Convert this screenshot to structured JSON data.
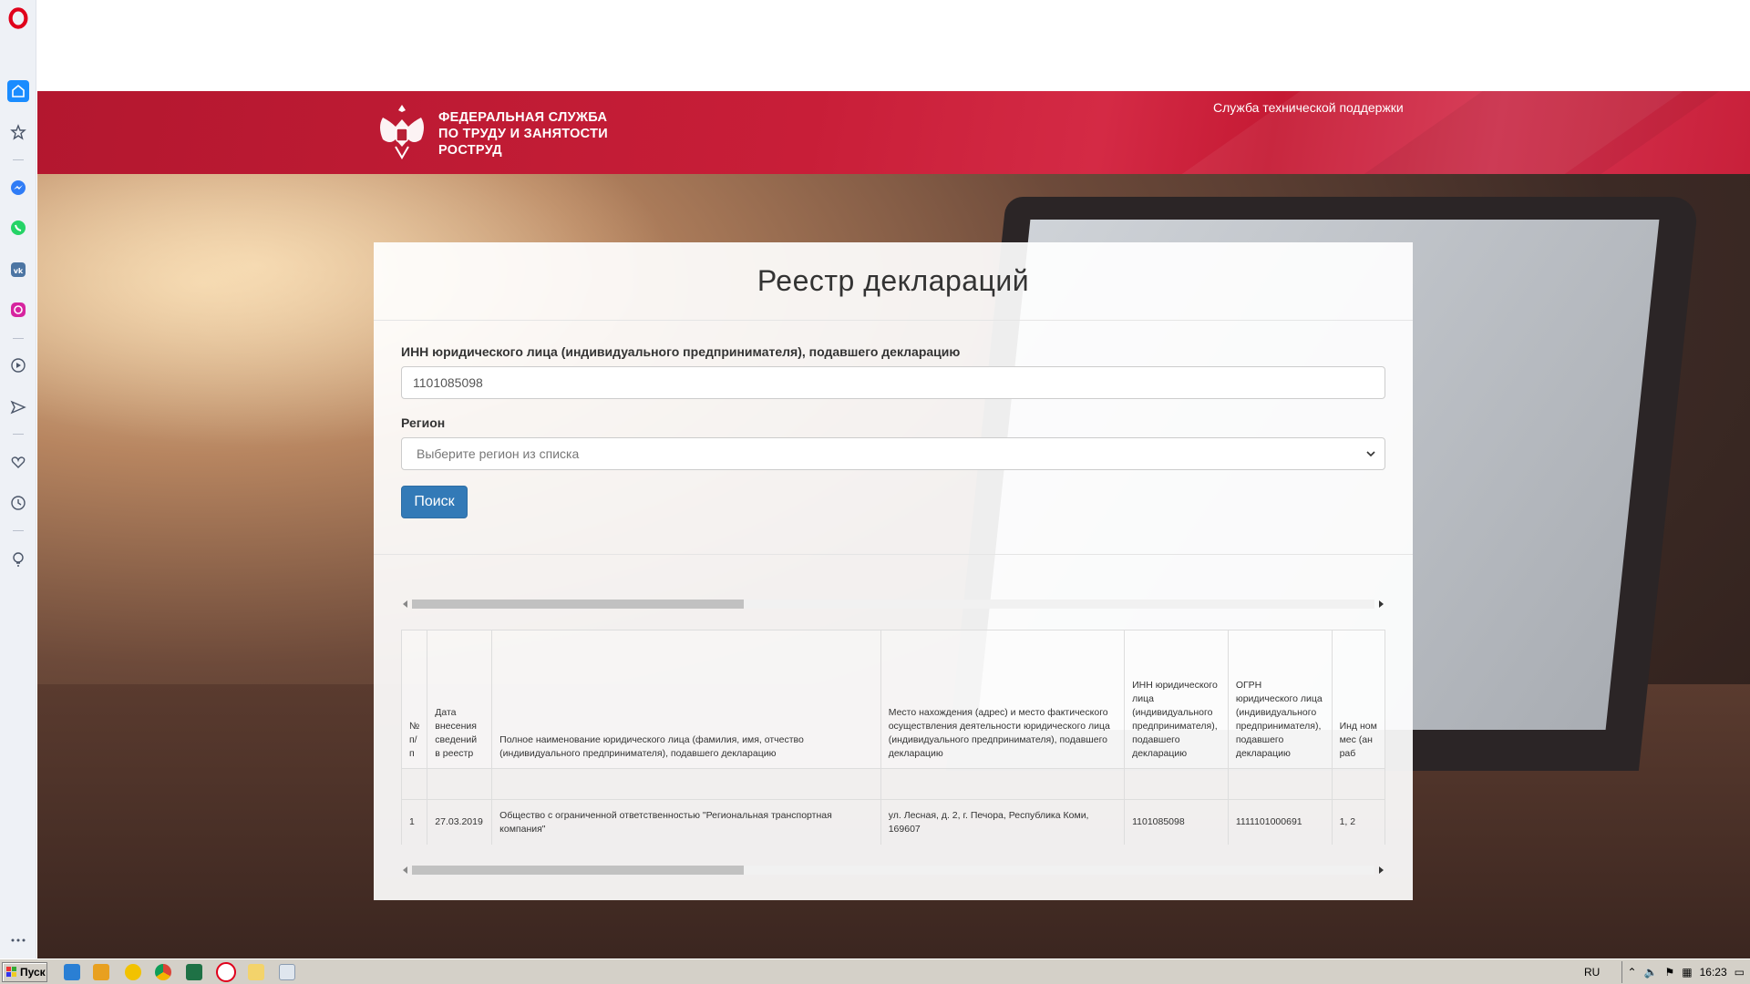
{
  "header": {
    "org_name_line1": "ФЕДЕРАЛЬНАЯ СЛУЖБА",
    "org_name_line2": "ПО ТРУДУ И ЗАНЯТОСТИ",
    "org_name_line3": "РОСТРУД",
    "support_link": "Служба технической поддержки"
  },
  "form": {
    "title": "Реестр деклараций",
    "inn_label": "ИНН юридического лица (индивидуального предпринимателя), подавшего декларацию",
    "inn_value": "1101085098",
    "region_label": "Регион",
    "region_placeholder": "Выберите регион из списка",
    "search_button": "Поиск"
  },
  "table": {
    "headers": [
      "№ п/п",
      "Дата внесения сведений в реестр",
      "Полное наименование юридического лица (фамилия, имя, отчество (индивидуального предпринимателя), подавшего декларацию",
      "Место нахождения (адрес) и место фактического осуществления деятельности юридического лица (индивидуального предпринимателя), подавшего декларацию",
      "ИНН юридического лица (индивидуального предпринимателя), подавшего декларацию",
      "ОГРН юридического лица (индивидуального предпринимателя), подавшего декларацию",
      "Инд ном мес (ан раб"
    ],
    "rows": [
      [
        "1",
        "27.03.2019",
        "Общество с ограниченной ответственностью \"Региональная транспортная компания\"",
        "ул. Лесная, д. 2, г. Печора, Республика Коми, 169607",
        "1101085098",
        "1111101000691",
        "1, 2"
      ]
    ]
  },
  "sidebar": {
    "icons": [
      "opera-logo-icon",
      "home-icon",
      "star-icon",
      "messenger-icon",
      "whatsapp-icon",
      "vk-icon",
      "instagram-icon",
      "player-icon",
      "send-icon",
      "heart-icon",
      "clock-icon",
      "bulb-icon",
      "more-icon"
    ]
  },
  "taskbar": {
    "start_label": "Пуск",
    "lang": "RU",
    "time": "16:23"
  },
  "colors": {
    "banner_red": "#c81e38",
    "button_blue": "#337ab7",
    "opera_red": "#e0001b",
    "sidebar_active": "#1a8cff"
  }
}
